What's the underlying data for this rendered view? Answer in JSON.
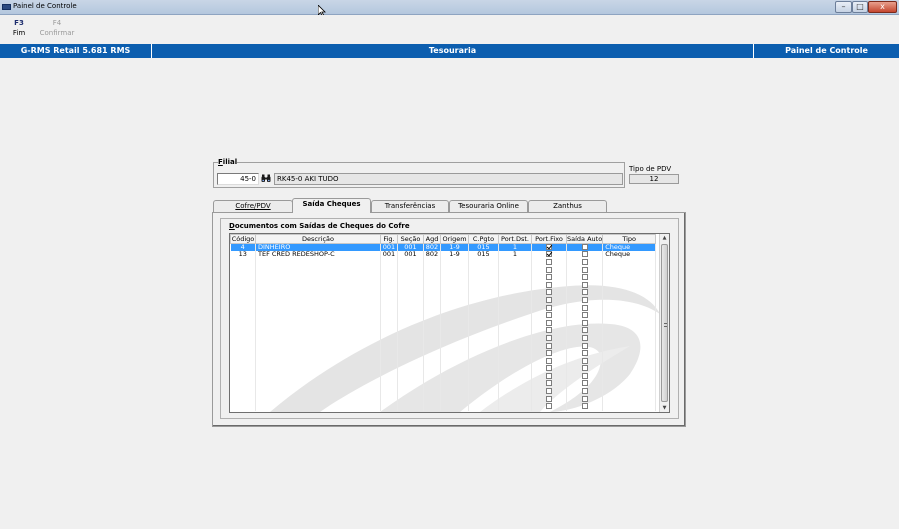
{
  "window": {
    "title": "Painel de Controle",
    "min_glyph": "–",
    "max_glyph": "□",
    "close_glyph": "x"
  },
  "toolbar": {
    "keys": [
      {
        "key": "F3",
        "label": "Fim",
        "enabled": true
      },
      {
        "key": "F4",
        "label": "Confirmar",
        "enabled": false
      }
    ]
  },
  "header": {
    "left": "G-RMS Retail 5.681 RMS",
    "center": "Tesouraria",
    "right": "Painel de Controle"
  },
  "filial": {
    "label_prefix": "",
    "label_underlined": "F",
    "label_rest": "ilial",
    "code": "45-0",
    "name": "RK45-0 AKI TUDO",
    "tipo_pdv_label": "Tipo de PDV",
    "tipo_pdv_value": "12"
  },
  "tabs": [
    {
      "label": "Cofre/PDV",
      "underline": "C",
      "active": false
    },
    {
      "label": "Saída Cheques",
      "underline": "S",
      "active": true
    },
    {
      "label": "Transferências",
      "underline": "",
      "active": false
    },
    {
      "label": "Tesouraria Online",
      "underline": "",
      "active": false
    },
    {
      "label": "Zanthus",
      "underline": "",
      "active": false
    }
  ],
  "documents": {
    "label_underlined": "D",
    "label_rest": "ocumentos com Saídas de Cheques do Cofre",
    "columns": [
      "Código",
      "Descrição",
      "Fig.",
      "Seção",
      "Agd",
      "Origem",
      "C.Pgto",
      "Port.Dst.",
      "Port.Fixo",
      "Saída Auto",
      "Tipo"
    ],
    "rows": [
      {
        "codigo": "4",
        "descricao": "DINHEIRO",
        "fig": "001",
        "secao": "001",
        "agd": "802",
        "origem": "1-9",
        "cpgto": "015",
        "portdst": "1",
        "portfixo": true,
        "saidaauto": false,
        "tipo": "Cheque",
        "selected": true
      },
      {
        "codigo": "13",
        "descricao": "TEF CRED REDESHOP-C",
        "fig": "001",
        "secao": "001",
        "agd": "802",
        "origem": "1-9",
        "cpgto": "015",
        "portdst": "1",
        "portfixo": true,
        "saidaauto": false,
        "tipo": "Cheque",
        "selected": false
      }
    ],
    "empty_rows": 20
  },
  "colors": {
    "header_blue": "#0c5eaf",
    "selection": "#3399ff",
    "window_bg": "#f0f0f0"
  }
}
